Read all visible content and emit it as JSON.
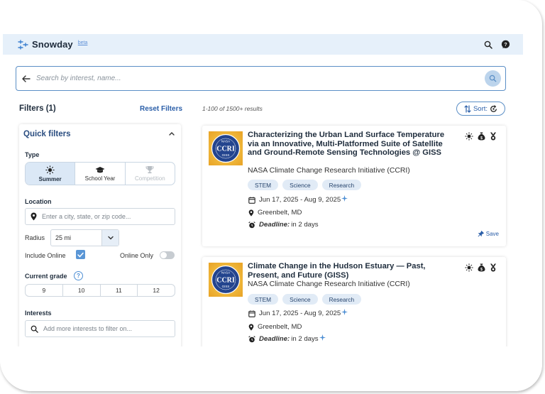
{
  "app": {
    "name": "Snowday",
    "badge": "beta"
  },
  "search": {
    "placeholder": "Search by interest, name..."
  },
  "filters": {
    "title": "Filters (1)",
    "reset_label": "Reset Filters",
    "results_text": "1-100 of 1500+ results",
    "sort_label": "Sort:"
  },
  "quick_filters": {
    "title": "Quick filters",
    "type_label": "Type",
    "types": [
      {
        "label": "Summer",
        "icon": "sun-icon",
        "selected": true
      },
      {
        "label": "School Year",
        "icon": "graduation-cap-icon",
        "selected": false
      },
      {
        "label": "Competition",
        "icon": "trophy-icon",
        "disabled": true
      }
    ],
    "location_label": "Location",
    "location_placeholder": "Enter a city, state, or zip code...",
    "radius_label": "Radius",
    "radius_value": "25 mi",
    "include_online_label": "Include Online",
    "include_online_checked": true,
    "online_only_label": "Online Only",
    "online_only_on": false,
    "grade_label": "Current grade",
    "grades": [
      "9",
      "10",
      "11",
      "12"
    ],
    "interests_label": "Interests",
    "interests_placeholder": "Add more interests to filter on..."
  },
  "logo_text": {
    "top": "NASA",
    "mid": "CCRI",
    "bot": "GISS"
  },
  "programs": [
    {
      "title": "Characterizing the Urban Land Surface Temperature via an Innovative, Multi-Platformed Suite of Satellite and Ground-Remote Sensing Technologies @ GISS",
      "org": "NASA Climate Change Research Initiative (CCRI)",
      "tags": [
        "STEM",
        "Science",
        "Research"
      ],
      "dates": "Jun 17, 2025 - Aug 9, 2025",
      "location": "Greenbelt, MD",
      "deadline_label": "Deadline:",
      "deadline_value": "in 2 days",
      "save_label": "Save"
    },
    {
      "title": "Climate Change in the Hudson Estuary — Past, Present, and Future (GISS)",
      "org": "NASA Climate Change Research Initiative (CCRI)",
      "tags": [
        "STEM",
        "Science",
        "Research"
      ],
      "dates": "Jun 17, 2025 - Aug 9, 2025",
      "location": "Greenbelt, MD",
      "deadline_label": "Deadline:",
      "deadline_value": "in 2 days"
    }
  ],
  "colors": {
    "accent": "#2a5ea8",
    "header_bg": "#e6f0fa",
    "check": "#5a96d6"
  }
}
